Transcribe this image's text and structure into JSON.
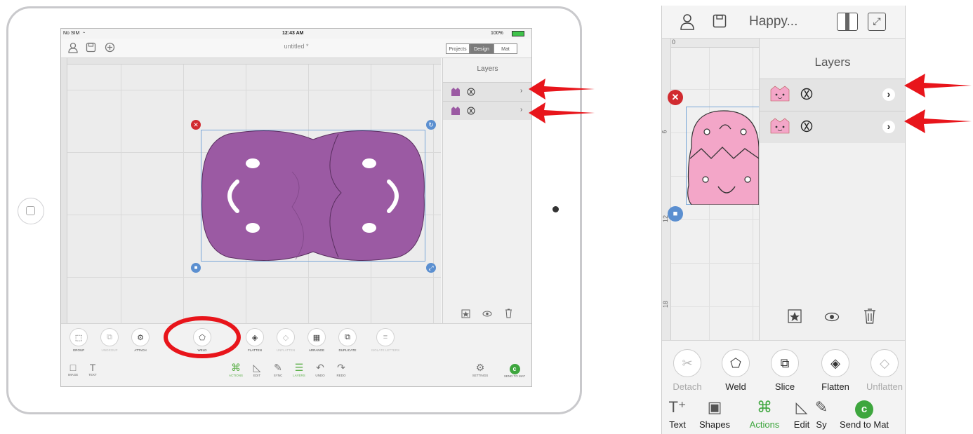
{
  "ipad": {
    "status": {
      "carrier": "No SIM",
      "time": "12:43 AM",
      "battery": "100%"
    },
    "title": "untitled *",
    "segments": [
      {
        "label": "Projects"
      },
      {
        "label": "Design"
      },
      {
        "label": "Mat"
      }
    ],
    "active_segment": "Design",
    "layers_title": "Layers",
    "tools": [
      {
        "label": "GROUP",
        "icon": "group-icon",
        "enabled": true
      },
      {
        "label": "UNGROUP",
        "icon": "ungroup-icon",
        "enabled": false
      },
      {
        "label": "ATTACH",
        "icon": "attach-icon",
        "enabled": true
      },
      {
        "label": "WELD",
        "icon": "weld-icon",
        "enabled": true
      },
      {
        "label": "FLATTEN",
        "icon": "flatten-icon",
        "enabled": true
      },
      {
        "label": "UNFLATTEN",
        "icon": "unflatten-icon",
        "enabled": false
      },
      {
        "label": "ARRANGE",
        "icon": "arrange-icon",
        "enabled": true
      },
      {
        "label": "DUPLICATE",
        "icon": "duplicate-icon",
        "enabled": true
      },
      {
        "label": "ISOLATE LETTERS",
        "icon": "isolate-letters-icon",
        "enabled": false
      }
    ],
    "left_nav": [
      {
        "label": "IMAGE"
      },
      {
        "label": "TEXT"
      }
    ],
    "center_nav": [
      {
        "label": "ACTIONS",
        "active": true
      },
      {
        "label": "EDIT",
        "active": false
      },
      {
        "label": "SYNC",
        "active": false
      },
      {
        "label": "LAYERS",
        "active": true
      },
      {
        "label": "UNDO",
        "active": false
      },
      {
        "label": "REDO",
        "active": false
      }
    ],
    "right_nav": [
      {
        "label": "SETTINGS"
      },
      {
        "label": "SEND TO MAT"
      }
    ],
    "shape_color": "#9b5aa3"
  },
  "phone": {
    "title": "Happy...",
    "layers_title": "Layers",
    "ruler_marks": [
      "0",
      "6",
      "12",
      "18"
    ],
    "tools": [
      {
        "label": "Detach",
        "enabled": false
      },
      {
        "label": "Weld",
        "enabled": true
      },
      {
        "label": "Slice",
        "enabled": true
      },
      {
        "label": "Flatten",
        "enabled": true
      },
      {
        "label": "Unflatten",
        "enabled": false
      }
    ],
    "nav": [
      {
        "label": "Text",
        "active": false
      },
      {
        "label": "Shapes",
        "active": false
      },
      {
        "label": "Actions",
        "active": true
      },
      {
        "label": "Edit",
        "active": false
      },
      {
        "label": "Sy",
        "active": false
      },
      {
        "label": "Send to Mat",
        "active": false
      }
    ],
    "shape_color": "#f3a6c8"
  },
  "annotation_color": "#e8151b"
}
